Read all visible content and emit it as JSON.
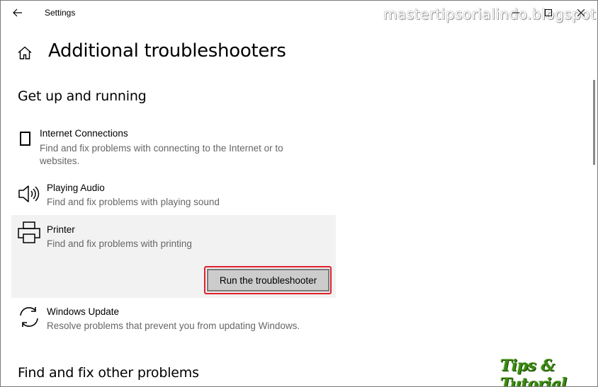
{
  "window": {
    "title": "Settings",
    "watermark": "mastertipsorialindo.blogspot.com"
  },
  "header": {
    "title": "Additional troubleshooters"
  },
  "sections": {
    "get_up": "Get up and running",
    "other": "Find and fix other problems"
  },
  "items": [
    {
      "name": "Internet Connections",
      "description": "Find and fix problems with connecting to the Internet or to websites.",
      "icon": "monitor-icon"
    },
    {
      "name": "Playing Audio",
      "description": "Find and fix problems with playing sound",
      "icon": "speaker-icon"
    },
    {
      "name": "Printer",
      "description": "Find and fix problems with printing",
      "icon": "printer-icon"
    },
    {
      "name": "Windows Update",
      "description": "Resolve problems that prevent you from updating Windows.",
      "icon": "sync-icon"
    }
  ],
  "actions": {
    "run_label": "Run the troubleshooter"
  },
  "brand": "Tips & Tutorial",
  "colors": {
    "highlight_border": "#e0202a",
    "selected_bg": "#f2f2f2",
    "brand_green": "#3a8a12"
  }
}
